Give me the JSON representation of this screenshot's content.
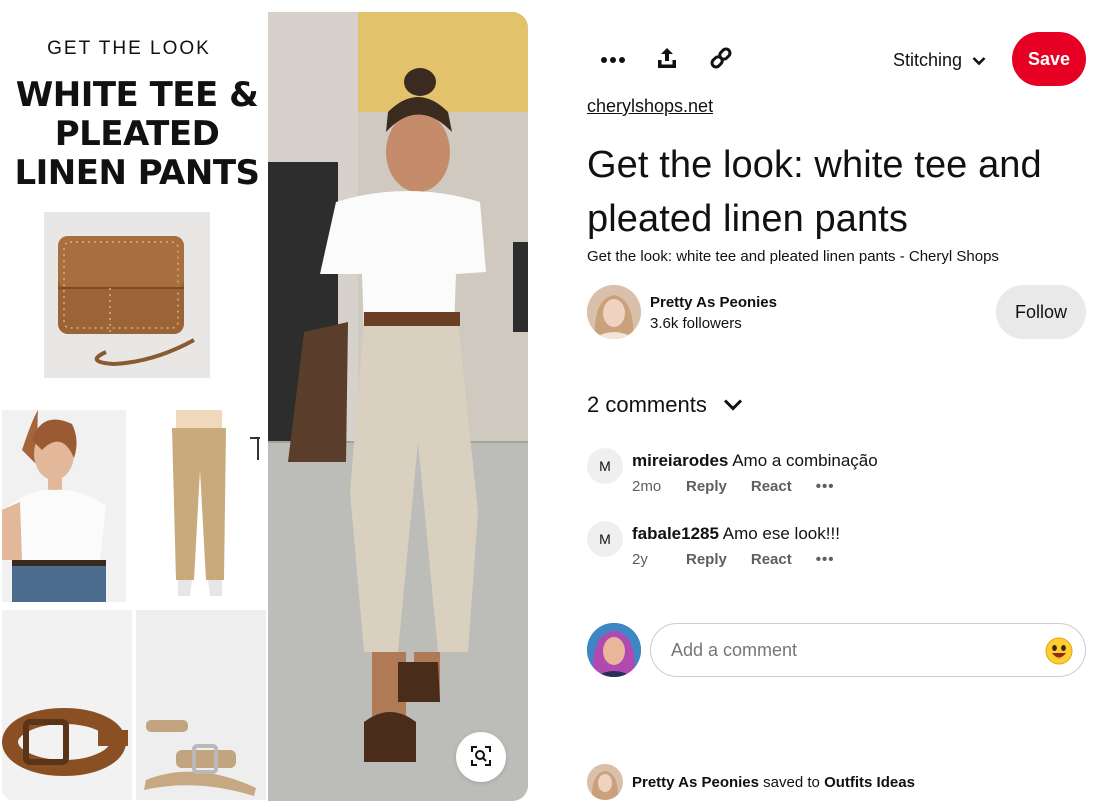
{
  "pin_image": {
    "kicker": "GET THE LOOK",
    "headline": "WHITE TEE & PLEATED LINEN PANTS",
    "visual_search_icon": "visual-search-icon"
  },
  "actions": {
    "more_icon": "more-options-icon",
    "share_icon": "share-icon",
    "link_icon": "link-icon",
    "board_name": "Stitching",
    "save_label": "Save",
    "save_color": "#e60023"
  },
  "pin": {
    "source_link": "cherylshops.net",
    "title": "Get the look: white tee and pleated linen pants",
    "description": "Get the look: white tee and pleated linen pants - Cheryl Shops"
  },
  "creator": {
    "name": "Pretty As Peonies",
    "followers": "3.6k followers",
    "follow_label": "Follow"
  },
  "comments": {
    "count_label": "2 comments",
    "items": [
      {
        "avatar_letter": "M",
        "user": "mireiarodes",
        "text": "Amo a combinação",
        "time": "2mo",
        "reply": "Reply",
        "react": "React",
        "more": "•••"
      },
      {
        "avatar_letter": "M",
        "user": "fabale1285",
        "text": "Amo ese look!!!",
        "time": "2y",
        "reply": "Reply",
        "react": "React",
        "more": "•••"
      }
    ],
    "input_placeholder": "Add a comment",
    "emoji_icon": "emoji-icon"
  },
  "saved_by": {
    "user": "Pretty As Peonies",
    "verb": "saved to",
    "board": "Outfits Ideas"
  }
}
